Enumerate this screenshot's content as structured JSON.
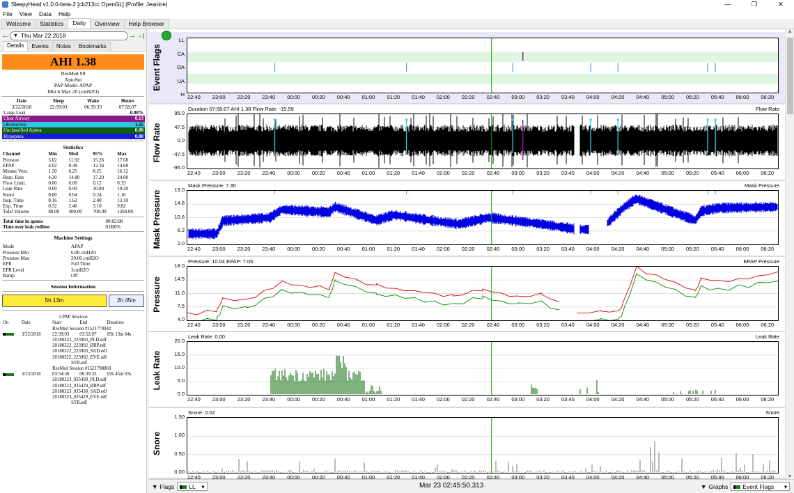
{
  "window": {
    "title": "SleepyHead v1.0.0-beta-2 [cb213cc OpenGL] (Profile: Jeanine)",
    "min": "—",
    "max": "❐",
    "close": "✕"
  },
  "menu": [
    "File",
    "View",
    "Data",
    "Help"
  ],
  "tabs": [
    "Welcome",
    "Statistics",
    "Daily",
    "Overview",
    "Help Browser"
  ],
  "active_tab": "Daily",
  "date_nav": {
    "prev": "←",
    "next": "→",
    "last": "→|",
    "date": "Thu Mar 22 2018"
  },
  "subtabs": [
    "Details",
    "Events",
    "Notes",
    "Bookmarks"
  ],
  "ahi": "AHI 1.38",
  "machine": {
    "model": "ResMed S9",
    "name": "AutoSet",
    "mode": "PAP Mode: APAP",
    "range": "Min 6 Max 20 (cmH2O)"
  },
  "sleep": {
    "headers": [
      "Date",
      "Sleep",
      "Wake",
      "Hours"
    ],
    "values": [
      "3/22/2018",
      "22:39:03",
      "06:39:33",
      "07:58:07"
    ]
  },
  "events": [
    {
      "name": "Large Leak",
      "value": "0.00%",
      "bg": "#ffffff",
      "fg": "#000000"
    },
    {
      "name": "Clear Airway",
      "value": "0.13",
      "bg": "#8a1a8a",
      "fg": "#ffffff"
    },
    {
      "name": "Obstructive",
      "value": "1.25",
      "bg": "#33c3e8",
      "fg": "#000000"
    },
    {
      "name": "Unclassified Apnea",
      "value": "0.00",
      "bg": "#0e5e0e",
      "fg": "#ffffff"
    },
    {
      "name": "Hypopnea",
      "value": "0.00",
      "bg": "#1a1adc",
      "fg": "#ffffff"
    }
  ],
  "stats": {
    "title": "Statistics",
    "headers": [
      "Channel",
      "Min",
      "Med",
      "95%",
      "Max"
    ],
    "rows": [
      [
        "Pressure",
        "5.02",
        "11.92",
        "15.26",
        "17.68"
      ],
      [
        "EPAP",
        "4.02",
        "9.38",
        "12.34",
        "14.68"
      ],
      [
        "Minute Vent.",
        "1.50",
        "6.25",
        "8.25",
        "16.12"
      ],
      [
        "Resp. Rate",
        "4.20",
        "14.80",
        "17.20",
        "24.00"
      ],
      [
        "Flow Limit.",
        "0.00",
        "0.00",
        "0.12",
        "0.35"
      ],
      [
        "Leak Rate",
        "0.00",
        "0.00",
        "10.80",
        "19.20"
      ],
      [
        "Snore",
        "0.00",
        "0.04",
        "0.24",
        "1.10"
      ],
      [
        "Insp. Time",
        "0.16",
        "1.62",
        "2.40",
        "13.10"
      ],
      [
        "Exp. Time",
        "0.32",
        "2.40",
        "3.10",
        "9.82"
      ],
      [
        "Tidal Volume",
        "80.00",
        "400.00",
        "700.00",
        "1260.00"
      ]
    ]
  },
  "apnea": [
    [
      "Total time in apnea",
      "00:02:08"
    ],
    [
      "Time over leak redline",
      "0.000%"
    ]
  ],
  "settings": {
    "title": "Machine Settings",
    "rows": [
      [
        "Mode",
        "APAP"
      ],
      [
        "Pressure Min",
        "6.00 cmH2O"
      ],
      [
        "Pressure Max",
        "20.00 cmH2O"
      ],
      [
        "EPR",
        "Full Time"
      ],
      [
        "EPR Level",
        "3cmH2O"
      ],
      [
        "Ramp",
        "Off"
      ]
    ]
  },
  "session": {
    "title": "Session Information",
    "bar1": "5h 13m",
    "bar2": "2h 45m",
    "frac1": 0.655
  },
  "cpap": {
    "title": "CPAP Sessions",
    "headers": [
      "On",
      "Date",
      "Start",
      "End",
      "Duration"
    ],
    "sessions": [
      {
        "label": "ResMed Session #1521779942",
        "date": "3/22/2018",
        "start": "22:39:03",
        "end": "03:52:07",
        "duration": "05h 13m 04s",
        "files": [
          "20180322_223903_PLD.edf",
          "20180322_223902_BRP.edf",
          "20180322_223903_SAD.edf",
          "20180322_223902_EVE.edf",
          "STR.edf"
        ]
      },
      {
        "label": "ResMed Session #1521798869",
        "date": "3/23/2018",
        "start": "03:54:30",
        "end": "06:39:33",
        "duration": "02h 45m 03s",
        "files": [
          "20180323_035430_PLD.edf",
          "20180323_035429_BRP.edf",
          "20180323_035430_SAD.edf",
          "20180323_035429_EVE.edf",
          "STR.edf"
        ]
      }
    ]
  },
  "time_axis": [
    "22:40",
    "23:00",
    "23:20",
    "23:40",
    "00:00",
    "00:20",
    "00:40",
    "01:00",
    "01:20",
    "01:40",
    "02:00",
    "02:20",
    "02:40",
    "03:00",
    "03:20",
    "03:40",
    "04:00",
    "04:20",
    "04:40",
    "05:00",
    "05:20",
    "05:40",
    "06:00",
    "06:20"
  ],
  "graphs": {
    "flags": {
      "title": "Event Flags",
      "rows": [
        "LL",
        "CA",
        "OA",
        "UA",
        "H"
      ]
    },
    "flow": {
      "title": "Flow Rate",
      "info": "Duration 07:58:07 AHI 1.38 Flow Rate: -15.59",
      "legend": "Flow Rate",
      "yticks": [
        "95.0",
        "47.5",
        "0.0",
        "-47.5",
        "-95.0"
      ]
    },
    "mask": {
      "title": "Mask Pressure",
      "info": "Mask Pressure: 7.30",
      "legend": "Mask Pressure",
      "yticks": [
        "19.0",
        "14.8",
        "10.6",
        "6.2",
        "2.0"
      ]
    },
    "pressure": {
      "title": "Pressure",
      "info": "Pressure: 10.04 EPAP: 7.05",
      "legend": "EPAP Pressure",
      "yticks": [
        "18.0",
        "14.5",
        "11.0",
        "7.5",
        "4.0"
      ]
    },
    "leak": {
      "title": "Leak Rate",
      "info": "Leak Rate: 0.00",
      "legend": "Leak Rate",
      "yticks": [
        "20.0",
        "15.0",
        "10.0",
        "5.0",
        "0.0"
      ]
    },
    "snore": {
      "title": "Snore",
      "info": "Snore: 0.02",
      "legend": "Snore",
      "yticks": [
        "1.50",
        "1.00",
        "0.50",
        "0.00"
      ]
    }
  },
  "bottom": {
    "flags_label": "Flags",
    "flags_value": "LL",
    "cursor_time": "Mar 23 02:45:50.313",
    "graphs_label": "Graphs",
    "graphs_value": "Event Flags"
  },
  "colors": {
    "ahi": "#ff8c1a",
    "flow": "#000000",
    "mask": "#0000e0",
    "pressure": "#e00000",
    "epap": "#008800",
    "leak": "#006600",
    "snore": "#555555",
    "cursor": "#00b000"
  }
}
